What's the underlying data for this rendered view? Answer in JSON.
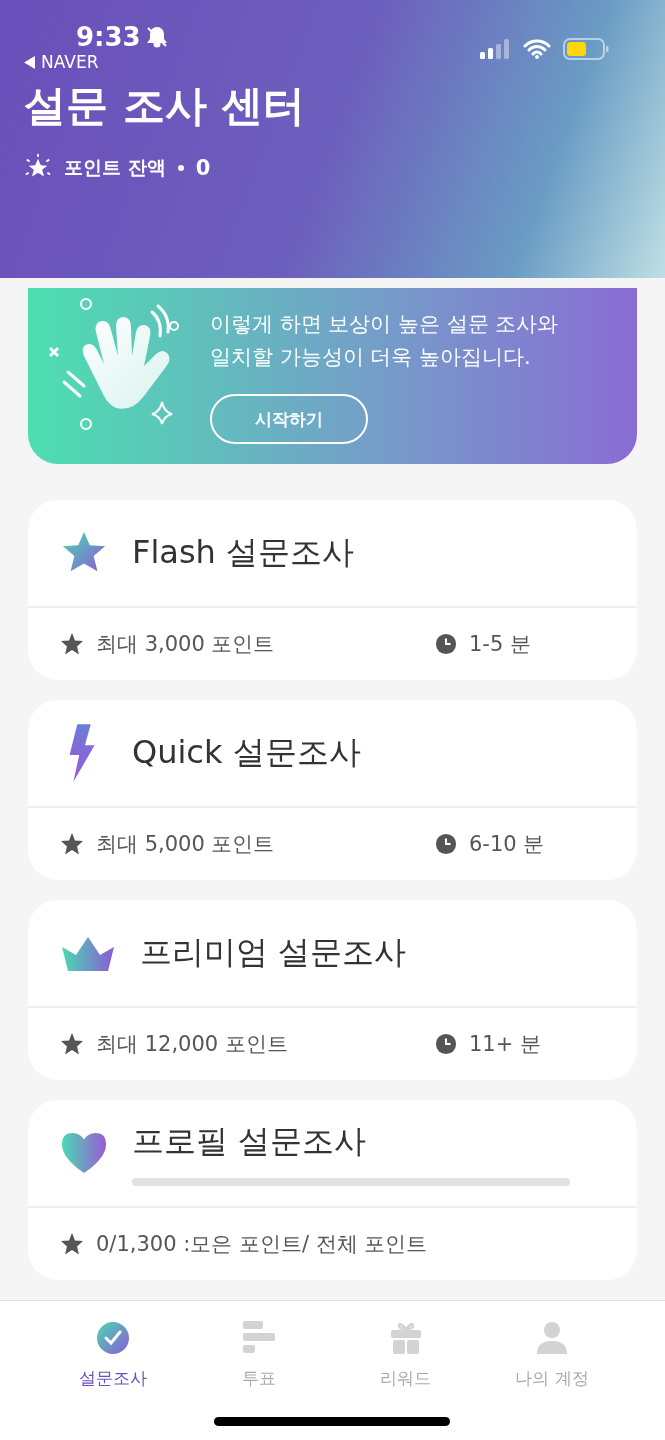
{
  "status_bar": {
    "time": "9:33",
    "back_label": "NAVER"
  },
  "header": {
    "title": "설문 조사 센터",
    "balance_label": "포인트 잔액",
    "balance_value": "0"
  },
  "banner": {
    "lines": [
      "이렇게 하면 보상이 높은 설문 조사와",
      "일치할 가능성이 더욱 높아집니다."
    ],
    "button": "시작하기"
  },
  "cards": [
    {
      "kind": "flash",
      "title": "Flash 설문조사",
      "points": "최대 3,000 포인트",
      "time": "1-5 분"
    },
    {
      "kind": "quick",
      "title": "Quick 설문조사",
      "points": "최대 5,000 포인트",
      "time": "6-10 분"
    },
    {
      "kind": "premium",
      "title": "프리미엄 설문조사",
      "points": "최대 12,000 포인트",
      "time": "11+ 분"
    },
    {
      "kind": "profile",
      "title": "프로필 설문조사",
      "level": 0,
      "points": "0/1,300 :모은 포인트/ 전체 포인트"
    }
  ],
  "tabs": [
    {
      "kind": "survey",
      "label": "설문조사",
      "selected": true
    },
    {
      "kind": "vote",
      "label": "투표",
      "selected": false
    },
    {
      "kind": "reward",
      "label": "리워드",
      "selected": false
    },
    {
      "kind": "account",
      "label": "나의 계정",
      "selected": false
    }
  ]
}
